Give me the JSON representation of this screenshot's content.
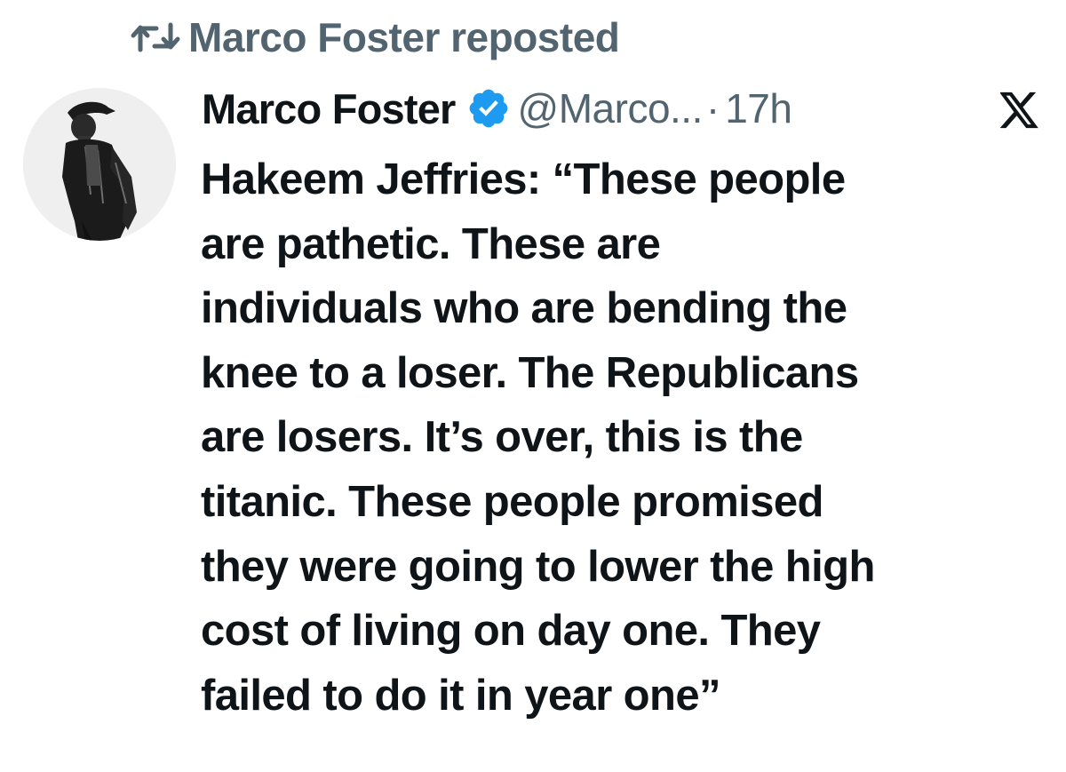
{
  "repost": {
    "icon": "repost-icon",
    "label": "Marco Foster reposted"
  },
  "author": {
    "name": "Marco Foster",
    "handle": "@Marco...",
    "separator": "·",
    "time": "17h",
    "verified": true,
    "verified_color": "#1d9bf0",
    "avatar_icon": "avatar-photo"
  },
  "platform_icon": "x-logo-icon",
  "post": {
    "lines": [
      "Hakeem Jeffries: “These people",
      "are pathetic. These are",
      "individuals who are bending the",
      "knee to a loser. The Republicans",
      "are losers. It’s over, this is the",
      "titanic. These people promised",
      "they were going to lower the high",
      "cost of living on day one. They",
      "failed to do it in year one”"
    ]
  },
  "colors": {
    "text_primary": "#0f1419",
    "text_secondary": "#536471",
    "background": "#ffffff"
  }
}
